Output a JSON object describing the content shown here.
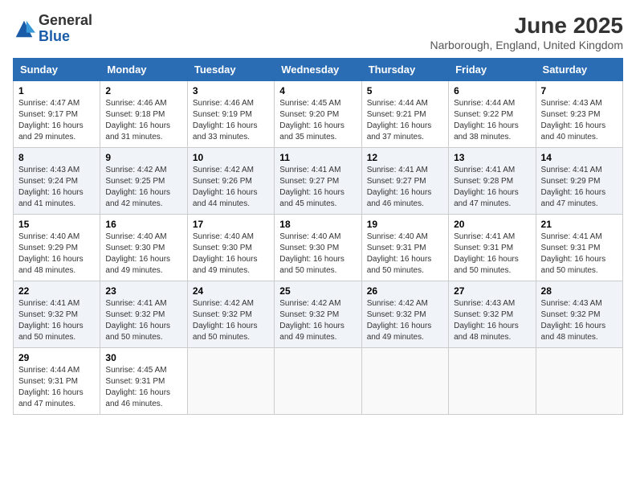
{
  "logo": {
    "general": "General",
    "blue": "Blue"
  },
  "title": "June 2025",
  "location": "Narborough, England, United Kingdom",
  "days_header": [
    "Sunday",
    "Monday",
    "Tuesday",
    "Wednesday",
    "Thursday",
    "Friday",
    "Saturday"
  ],
  "weeks": [
    [
      {
        "day": "1",
        "sunrise": "4:47 AM",
        "sunset": "9:17 PM",
        "daylight": "16 hours and 29 minutes."
      },
      {
        "day": "2",
        "sunrise": "4:46 AM",
        "sunset": "9:18 PM",
        "daylight": "16 hours and 31 minutes."
      },
      {
        "day": "3",
        "sunrise": "4:46 AM",
        "sunset": "9:19 PM",
        "daylight": "16 hours and 33 minutes."
      },
      {
        "day": "4",
        "sunrise": "4:45 AM",
        "sunset": "9:20 PM",
        "daylight": "16 hours and 35 minutes."
      },
      {
        "day": "5",
        "sunrise": "4:44 AM",
        "sunset": "9:21 PM",
        "daylight": "16 hours and 37 minutes."
      },
      {
        "day": "6",
        "sunrise": "4:44 AM",
        "sunset": "9:22 PM",
        "daylight": "16 hours and 38 minutes."
      },
      {
        "day": "7",
        "sunrise": "4:43 AM",
        "sunset": "9:23 PM",
        "daylight": "16 hours and 40 minutes."
      }
    ],
    [
      {
        "day": "8",
        "sunrise": "4:43 AM",
        "sunset": "9:24 PM",
        "daylight": "16 hours and 41 minutes."
      },
      {
        "day": "9",
        "sunrise": "4:42 AM",
        "sunset": "9:25 PM",
        "daylight": "16 hours and 42 minutes."
      },
      {
        "day": "10",
        "sunrise": "4:42 AM",
        "sunset": "9:26 PM",
        "daylight": "16 hours and 44 minutes."
      },
      {
        "day": "11",
        "sunrise": "4:41 AM",
        "sunset": "9:27 PM",
        "daylight": "16 hours and 45 minutes."
      },
      {
        "day": "12",
        "sunrise": "4:41 AM",
        "sunset": "9:27 PM",
        "daylight": "16 hours and 46 minutes."
      },
      {
        "day": "13",
        "sunrise": "4:41 AM",
        "sunset": "9:28 PM",
        "daylight": "16 hours and 47 minutes."
      },
      {
        "day": "14",
        "sunrise": "4:41 AM",
        "sunset": "9:29 PM",
        "daylight": "16 hours and 47 minutes."
      }
    ],
    [
      {
        "day": "15",
        "sunrise": "4:40 AM",
        "sunset": "9:29 PM",
        "daylight": "16 hours and 48 minutes."
      },
      {
        "day": "16",
        "sunrise": "4:40 AM",
        "sunset": "9:30 PM",
        "daylight": "16 hours and 49 minutes."
      },
      {
        "day": "17",
        "sunrise": "4:40 AM",
        "sunset": "9:30 PM",
        "daylight": "16 hours and 49 minutes."
      },
      {
        "day": "18",
        "sunrise": "4:40 AM",
        "sunset": "9:30 PM",
        "daylight": "16 hours and 50 minutes."
      },
      {
        "day": "19",
        "sunrise": "4:40 AM",
        "sunset": "9:31 PM",
        "daylight": "16 hours and 50 minutes."
      },
      {
        "day": "20",
        "sunrise": "4:41 AM",
        "sunset": "9:31 PM",
        "daylight": "16 hours and 50 minutes."
      },
      {
        "day": "21",
        "sunrise": "4:41 AM",
        "sunset": "9:31 PM",
        "daylight": "16 hours and 50 minutes."
      }
    ],
    [
      {
        "day": "22",
        "sunrise": "4:41 AM",
        "sunset": "9:32 PM",
        "daylight": "16 hours and 50 minutes."
      },
      {
        "day": "23",
        "sunrise": "4:41 AM",
        "sunset": "9:32 PM",
        "daylight": "16 hours and 50 minutes."
      },
      {
        "day": "24",
        "sunrise": "4:42 AM",
        "sunset": "9:32 PM",
        "daylight": "16 hours and 50 minutes."
      },
      {
        "day": "25",
        "sunrise": "4:42 AM",
        "sunset": "9:32 PM",
        "daylight": "16 hours and 49 minutes."
      },
      {
        "day": "26",
        "sunrise": "4:42 AM",
        "sunset": "9:32 PM",
        "daylight": "16 hours and 49 minutes."
      },
      {
        "day": "27",
        "sunrise": "4:43 AM",
        "sunset": "9:32 PM",
        "daylight": "16 hours and 48 minutes."
      },
      {
        "day": "28",
        "sunrise": "4:43 AM",
        "sunset": "9:32 PM",
        "daylight": "16 hours and 48 minutes."
      }
    ],
    [
      {
        "day": "29",
        "sunrise": "4:44 AM",
        "sunset": "9:31 PM",
        "daylight": "16 hours and 47 minutes."
      },
      {
        "day": "30",
        "sunrise": "4:45 AM",
        "sunset": "9:31 PM",
        "daylight": "16 hours and 46 minutes."
      },
      null,
      null,
      null,
      null,
      null
    ]
  ]
}
